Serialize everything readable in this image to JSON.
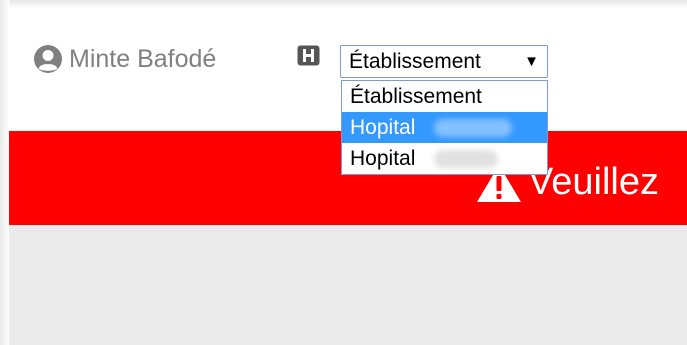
{
  "user": {
    "name": "Minte Bafodé",
    "icon": "user-circle-icon"
  },
  "establishment_select": {
    "icon": "hospital-icon",
    "selected_label": "Établissement",
    "arrow": "▼",
    "options": [
      {
        "label": "Établissement"
      },
      {
        "label": "Hopital"
      },
      {
        "label": "Hopital"
      }
    ],
    "highlighted_index": 1
  },
  "banner": {
    "icon": "warning-icon",
    "text": "Veuillez",
    "color": "#ff0000"
  },
  "colors": {
    "highlight": "#3399ff",
    "banner_bg": "#ff0000",
    "text_gray": "#808080",
    "body_bg": "#ebebeb"
  }
}
